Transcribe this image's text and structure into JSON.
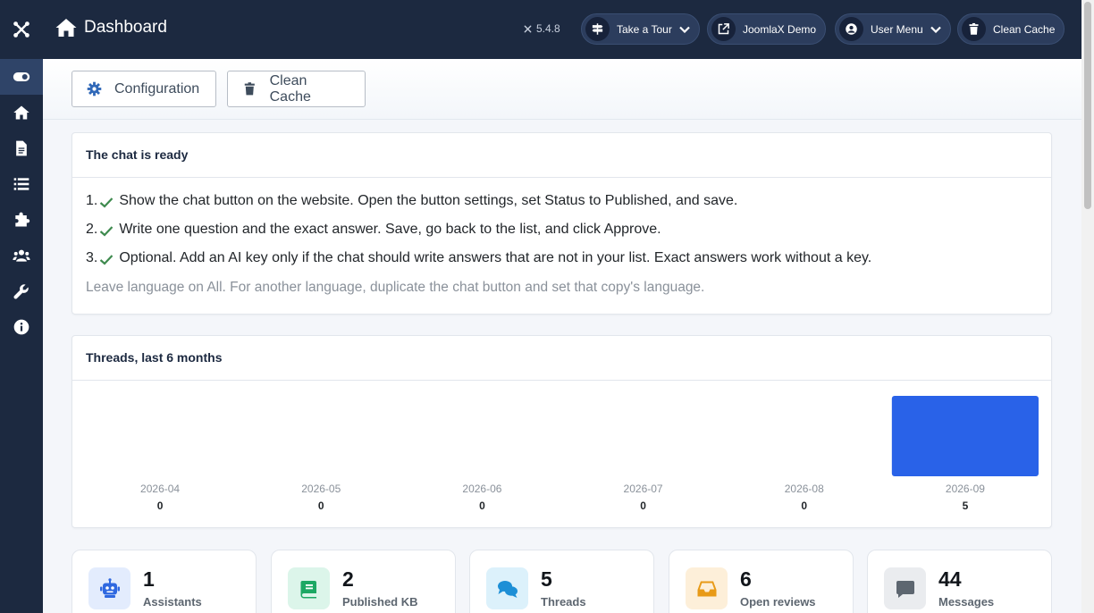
{
  "header": {
    "title": "Dashboard",
    "version": "5.4.8",
    "buttons": {
      "tour": "Take a Tour",
      "demo": "JoomlaX Demo",
      "user_menu": "User Menu",
      "clean_cache": "Clean Cache"
    }
  },
  "sidebar": {
    "icons": [
      "joomla-logo-icon",
      "toggle-icon",
      "home-icon",
      "document-icon",
      "list-icon",
      "puzzle-icon",
      "users-icon",
      "wrench-icon",
      "info-icon"
    ]
  },
  "toolbar": {
    "configuration": "Configuration",
    "clean_cache": "Clean Cache"
  },
  "chat_card": {
    "title": "The chat is ready",
    "steps": [
      {
        "num": "1.",
        "text": "Show the chat button on the website. Open the button settings, set Status to Published, and save."
      },
      {
        "num": "2.",
        "text": "Write one question and the exact answer. Save, go back to the list, and click Approve."
      },
      {
        "num": "3.",
        "text": "Optional. Add an AI key only if the chat should write answers that are not in your list. Exact answers work without a key."
      }
    ],
    "note": "Leave language on All. For another language, duplicate the chat button and set that copy's language."
  },
  "threads_card": {
    "title": "Threads, last 6 months"
  },
  "chart_data": {
    "type": "bar",
    "title": "Threads, last 6 months",
    "categories": [
      "2026-04",
      "2026-05",
      "2026-06",
      "2026-07",
      "2026-08",
      "2026-09"
    ],
    "values": [
      0,
      0,
      0,
      0,
      0,
      5
    ],
    "value_labels": [
      "0",
      "0",
      "0",
      "0",
      "0",
      "5"
    ],
    "xlabel": "",
    "ylabel": "",
    "ylim": [
      0,
      5
    ],
    "grid": false,
    "bar_color": "#2962e8"
  },
  "stats": [
    {
      "value": "1",
      "label": "Assistants",
      "icon": "robot-icon",
      "bg": "#e3ecfd",
      "fg": "#2f68e0"
    },
    {
      "value": "2",
      "label": "Published KB",
      "icon": "book-icon",
      "bg": "#dcf5ea",
      "fg": "#1da864"
    },
    {
      "value": "5",
      "label": "Threads",
      "icon": "comments-icon",
      "bg": "#dcf1fb",
      "fg": "#1d8fd6"
    },
    {
      "value": "6",
      "label": "Open reviews",
      "icon": "inbox-icon",
      "bg": "#fdefd9",
      "fg": "#e89a17"
    },
    {
      "value": "44",
      "label": "Messages",
      "icon": "message-icon",
      "bg": "#eaecef",
      "fg": "#5d6670"
    }
  ],
  "colors": {
    "header_bg": "#1c2940",
    "accent": "#2962e8",
    "check": "#3e8a4e"
  }
}
